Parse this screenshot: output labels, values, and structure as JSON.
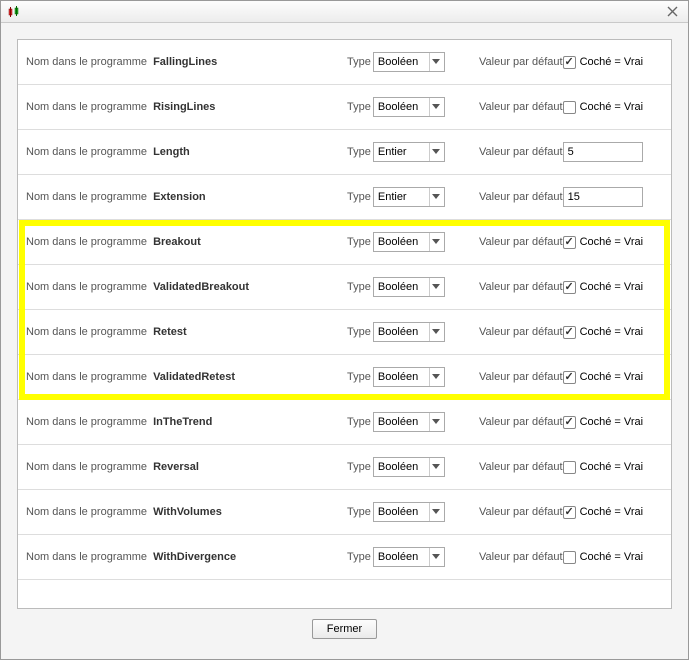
{
  "labels": {
    "name_in_program": "Nom dans le programme",
    "type": "Type",
    "default_value": "Valeur par défaut",
    "checked_true": "Coché = Vrai",
    "close_button": "Fermer"
  },
  "type_options": {
    "boolean": "Booléen",
    "integer": "Entier"
  },
  "highlight": {
    "start_index": 4,
    "end_index": 7
  },
  "rows": [
    {
      "name": "FallingLines",
      "type": "boolean",
      "default_kind": "check",
      "checked": true
    },
    {
      "name": "RisingLines",
      "type": "boolean",
      "default_kind": "check",
      "checked": false
    },
    {
      "name": "Length",
      "type": "integer",
      "default_kind": "number",
      "value": "5"
    },
    {
      "name": "Extension",
      "type": "integer",
      "default_kind": "number",
      "value": "15"
    },
    {
      "name": "Breakout",
      "type": "boolean",
      "default_kind": "check",
      "checked": true
    },
    {
      "name": "ValidatedBreakout",
      "type": "boolean",
      "default_kind": "check",
      "checked": true
    },
    {
      "name": "Retest",
      "type": "boolean",
      "default_kind": "check",
      "checked": true
    },
    {
      "name": "ValidatedRetest",
      "type": "boolean",
      "default_kind": "check",
      "checked": true
    },
    {
      "name": "InTheTrend",
      "type": "boolean",
      "default_kind": "check",
      "checked": true
    },
    {
      "name": "Reversal",
      "type": "boolean",
      "default_kind": "check",
      "checked": false
    },
    {
      "name": "WithVolumes",
      "type": "boolean",
      "default_kind": "check",
      "checked": true
    },
    {
      "name": "WithDivergence",
      "type": "boolean",
      "default_kind": "check",
      "checked": false
    }
  ]
}
